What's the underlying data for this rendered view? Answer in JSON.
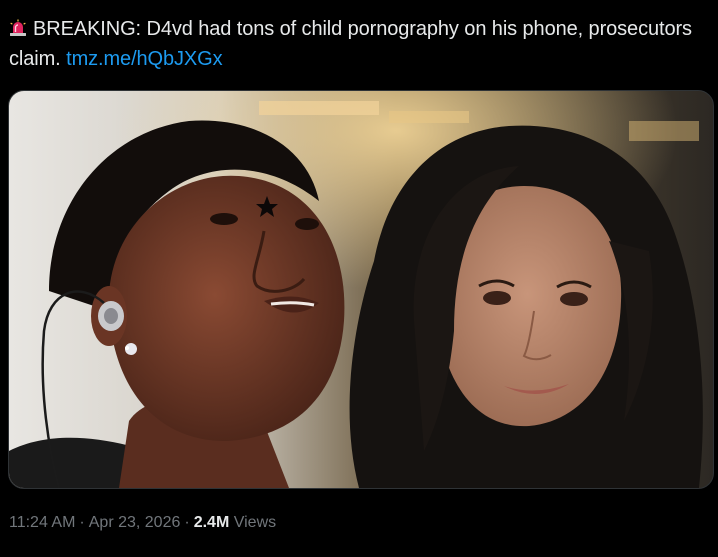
{
  "tweet": {
    "headline": "BREAKING: D4vd had tons of child pornography on his phone, prosecutors claim.",
    "link": "tmz.me/hQbJXGx",
    "icon": "police-siren-icon"
  },
  "media": {
    "description_icon": "photo"
  },
  "meta": {
    "time": "11:24 AM",
    "separator": "·",
    "date": "Apr 23, 2026",
    "views_count": "2.4M",
    "views_label": "Views"
  },
  "colors": {
    "text": "#e7e9ea",
    "link": "#1d9bf0",
    "muted": "#71767b",
    "background": "#000000"
  }
}
